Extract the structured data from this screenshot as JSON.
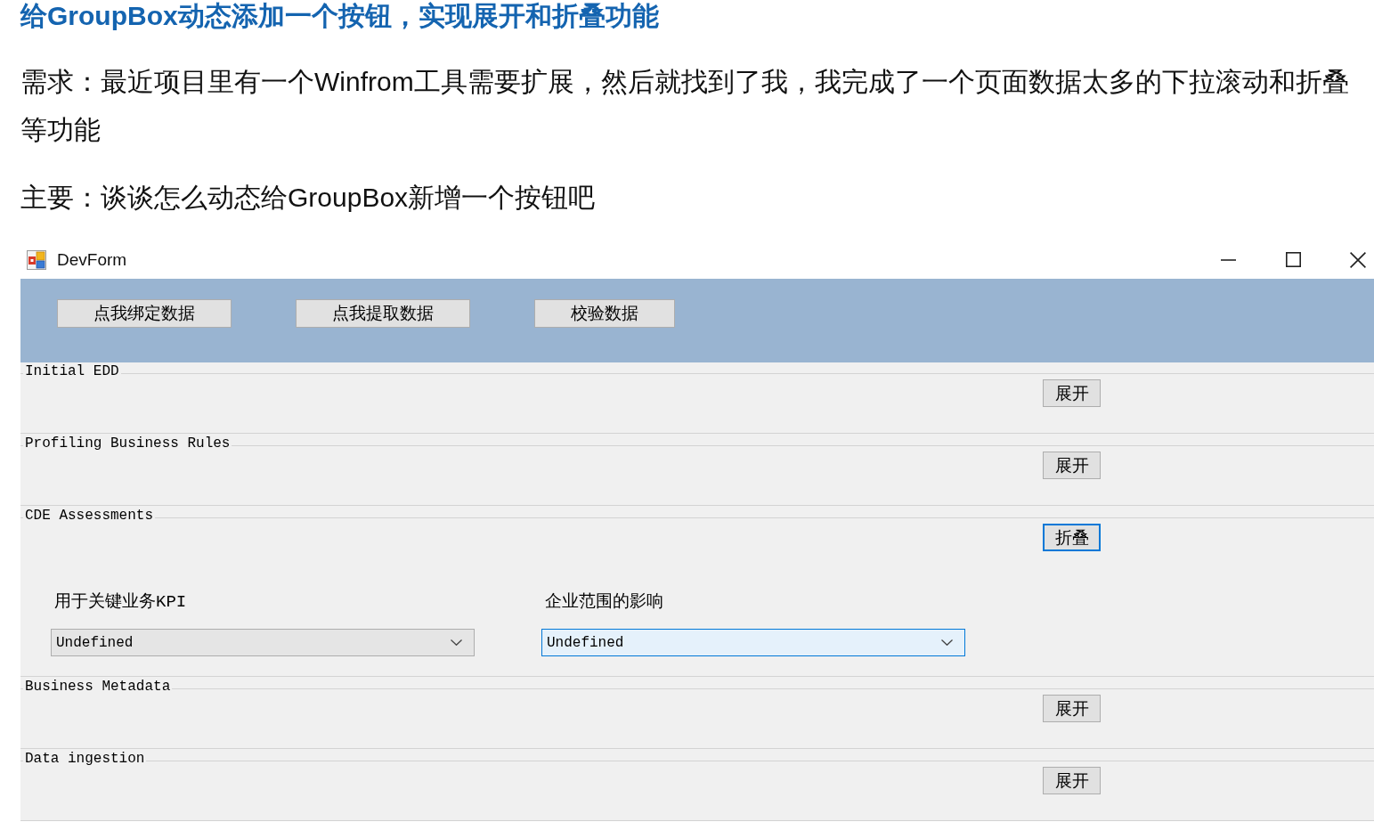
{
  "article": {
    "heading": "给GroupBox动态添加一个按钮，实现展开和折叠功能",
    "paragraphs": [
      "需求：最近项目里有一个Winfrom工具需要扩展，然后就找到了我，我完成了一个页面数据太多的下拉滚动和折叠等功能",
      "主要：谈谈怎么动态给GroupBox新增一个按钮吧"
    ]
  },
  "window": {
    "title": "DevForm",
    "toolbar_buttons": [
      "点我绑定数据",
      "点我提取数据",
      "校验数据"
    ],
    "groups": [
      {
        "title": "Initial EDD",
        "expanded": false,
        "toggle": {
          "label": "展开",
          "focused": false
        }
      },
      {
        "title": "Profiling Business Rules",
        "expanded": false,
        "toggle": {
          "label": "展开",
          "focused": false
        }
      },
      {
        "title": "CDE Assessments",
        "expanded": true,
        "toggle": {
          "label": "折叠",
          "focused": true
        },
        "fields": [
          {
            "label": "用于关键业务KPI",
            "value": "Undefined",
            "highlighted": false
          },
          {
            "label": "企业范围的影响",
            "value": "Undefined",
            "highlighted": true
          }
        ]
      },
      {
        "title": "Business Metadata",
        "expanded": false,
        "toggle": {
          "label": "展开",
          "focused": false
        }
      },
      {
        "title": "Data ingestion",
        "expanded": false,
        "toggle": {
          "label": "展开",
          "focused": false
        }
      }
    ]
  }
}
